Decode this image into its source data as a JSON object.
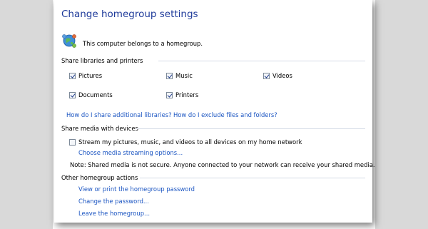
{
  "window": {
    "title": "Change homegroup settings"
  },
  "status": {
    "text": "This computer belongs to a homegroup.",
    "icon": "homegroup-icon"
  },
  "share_libraries": {
    "heading": "Share libraries and printers",
    "items": [
      {
        "label": "Pictures",
        "checked": true
      },
      {
        "label": "Music",
        "checked": true
      },
      {
        "label": "Videos",
        "checked": true
      },
      {
        "label": "Documents",
        "checked": true
      },
      {
        "label": "Printers",
        "checked": true
      }
    ],
    "link_additional": "How do I share additional libraries?",
    "link_exclude": "How do I exclude files and folders?"
  },
  "share_media": {
    "heading": "Share media with devices",
    "stream_label": "Stream my pictures, music, and videos to all devices on my home network",
    "stream_checked": false,
    "options_link": "Choose media streaming options...",
    "note": "Note: Shared media is not secure. Anyone connected to your network can receive your shared media."
  },
  "other_actions": {
    "heading": "Other homegroup actions",
    "links": [
      "View or print the homegroup password",
      "Change the password...",
      "Leave the homegroup..."
    ]
  },
  "colors": {
    "title": "#1e3a9a",
    "link": "#1b55c2",
    "side_background": "#d9d9d9"
  }
}
